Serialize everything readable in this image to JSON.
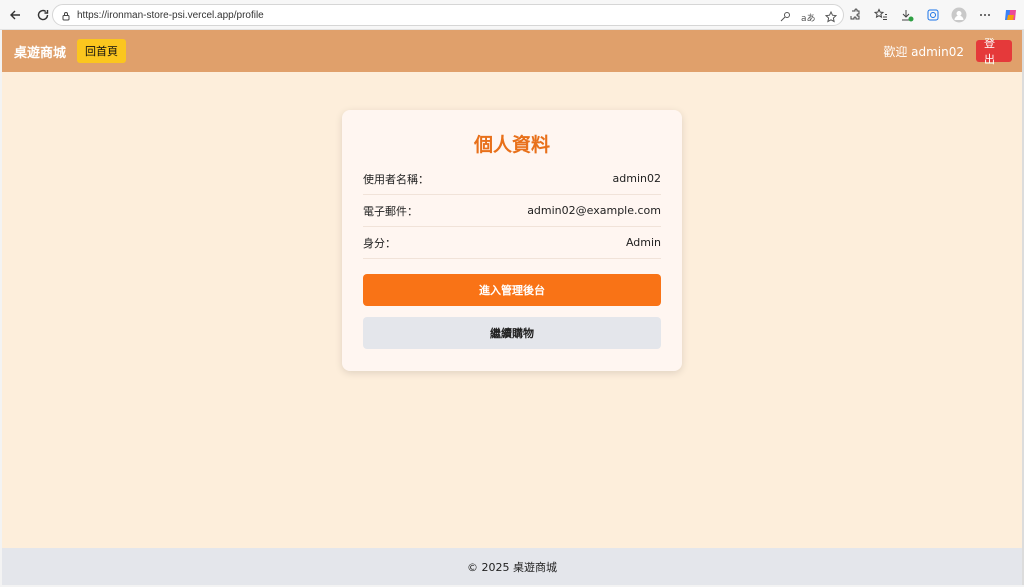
{
  "browser": {
    "url": "https://ironman-store-psi.vercel.app/profile"
  },
  "header": {
    "brand": "桌遊商城",
    "home_label": "回首頁",
    "welcome": "歡迎 admin02",
    "logout_label": "登出"
  },
  "profile": {
    "title": "個人資料",
    "rows": [
      {
        "label": "使用者名稱：",
        "value": "admin02"
      },
      {
        "label": "電子郵件：",
        "value": "admin02@example.com"
      },
      {
        "label": "身分：",
        "value": "Admin"
      }
    ],
    "admin_button": "進入管理後台",
    "continue_button": "繼續購物"
  },
  "footer": {
    "text": "© 2025 桌遊商城"
  },
  "colors": {
    "header_bg": "#e0a06b",
    "page_bg": "#fdeedb",
    "accent": "#f97316",
    "title": "#e8701a",
    "home_btn": "#fbc61e",
    "logout_btn": "#e5393a"
  }
}
